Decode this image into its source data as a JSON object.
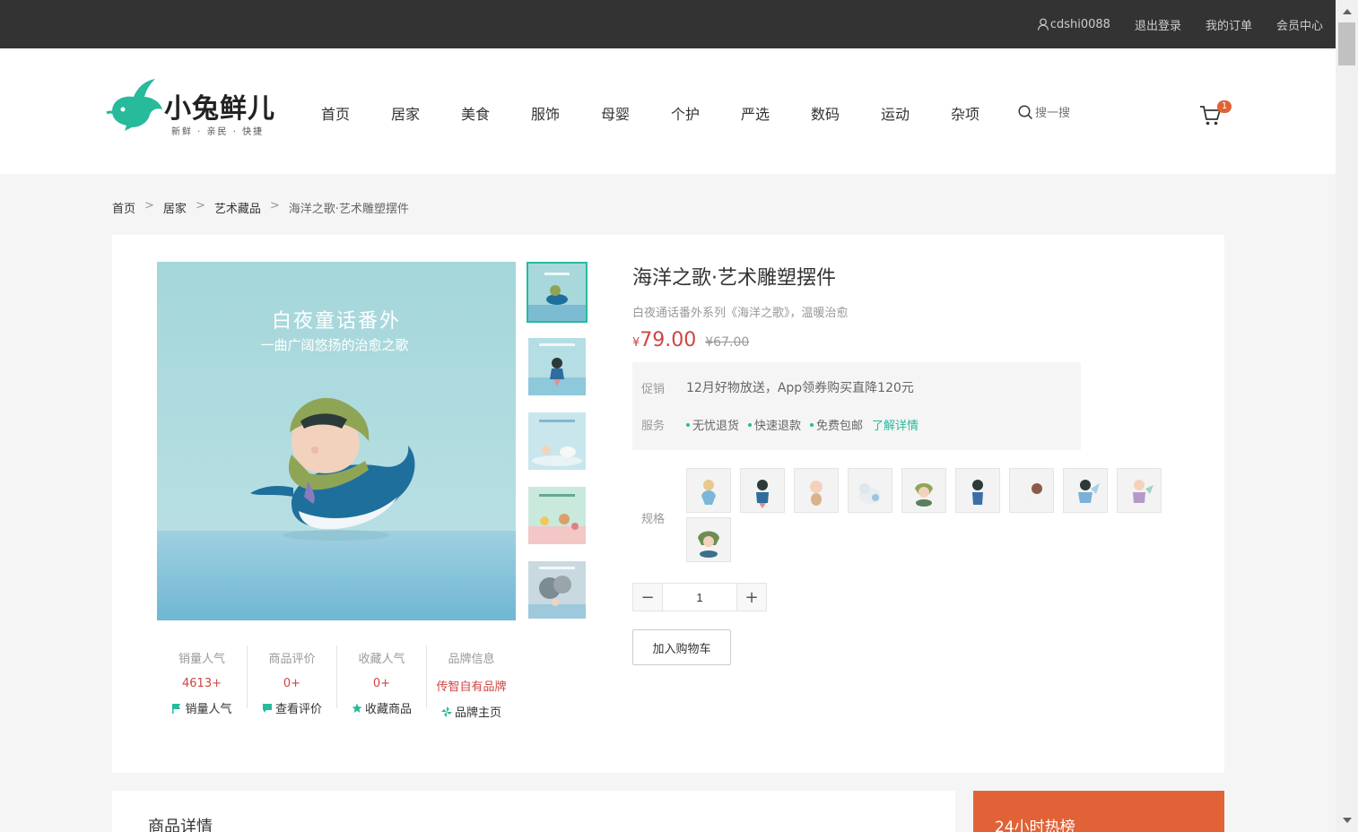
{
  "topbar": {
    "username": "cdshi0088",
    "logout": "退出登录",
    "orders": "我的订单",
    "member": "会员中心"
  },
  "logo": {
    "brand": "小兔鲜儿",
    "slogan": "新鲜 · 亲民 · 快捷"
  },
  "nav": [
    "首页",
    "居家",
    "美食",
    "服饰",
    "母婴",
    "个护",
    "严选",
    "数码",
    "运动",
    "杂项"
  ],
  "search": {
    "placeholder": "搜一搜"
  },
  "cart": {
    "count": "1"
  },
  "breadcrumb": [
    "首页",
    "居家",
    "艺术藏品",
    "海洋之歌·艺术雕塑摆件"
  ],
  "gallery": {
    "headline": "白夜童话番外",
    "subline": "一曲广阔悠扬的治愈之歌"
  },
  "stats": [
    {
      "label": "销量人气",
      "value": "4613+",
      "action": "销量人气",
      "icon": "flag-icon"
    },
    {
      "label": "商品评价",
      "value": "0+",
      "action": "查看评价",
      "icon": "comment-icon"
    },
    {
      "label": "收藏人气",
      "value": "0+",
      "action": "收藏商品",
      "icon": "star-icon"
    },
    {
      "label": "品牌信息",
      "value": "传智自有品牌",
      "action": "品牌主页",
      "icon": "brand-icon"
    }
  ],
  "product": {
    "name": "海洋之歌·艺术雕塑摆件",
    "desc": "白夜通话番外系列《海洋之歌》，温暖治愈",
    "currency": "¥",
    "price": "79.00",
    "old_price": "¥67.00"
  },
  "promo": {
    "promo_label": "促销",
    "promo_text": "12月好物放送，App领券购买直降120元",
    "service_label": "服务",
    "services": [
      "无忧退货",
      "快速退款",
      "免费包邮"
    ],
    "more": "了解详情"
  },
  "specs": {
    "label": "规格"
  },
  "quantity": {
    "value": "1",
    "minus": "−",
    "plus": "+"
  },
  "add_cart": "加入购物车",
  "detail": {
    "title": "商品详情"
  },
  "hot": {
    "title": "24小时热榜"
  },
  "colors": {
    "accent": "#27ba9b",
    "price": "#cf4444",
    "hot": "#e26237",
    "topbar": "#333333"
  }
}
